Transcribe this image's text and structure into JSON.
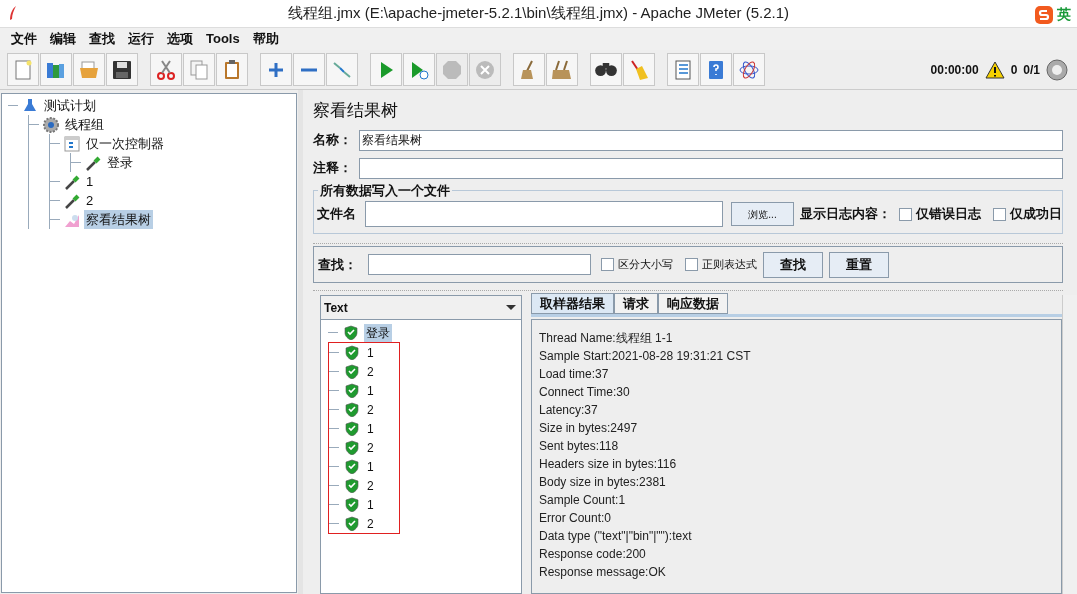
{
  "window": {
    "title": "线程组.jmx (E:\\apache-jmeter-5.2.1\\bin\\线程组.jmx) - Apache JMeter (5.2.1)"
  },
  "ime": {
    "label": "英"
  },
  "menu": [
    "文件",
    "编辑",
    "查找",
    "运行",
    "选项",
    "Tools",
    "帮助"
  ],
  "toolbar": [
    [
      {
        "disabled": false
      },
      {
        "disabled": false
      },
      {
        "disabled": false
      },
      {
        "disabled": false
      }
    ],
    [
      {
        "disabled": false
      },
      {
        "disabled": false
      },
      {
        "disabled": false
      }
    ],
    [
      {
        "disabled": false
      },
      {
        "disabled": false
      },
      {
        "disabled": false
      }
    ],
    [
      {
        "disabled": false
      },
      {
        "disabled": false
      },
      {
        "disabled": true
      },
      {
        "disabled": true
      }
    ],
    [
      {
        "disabled": false
      },
      {
        "disabled": false
      }
    ],
    [
      {
        "disabled": false
      },
      {
        "disabled": false
      }
    ],
    [
      {
        "disabled": false
      },
      {
        "disabled": false
      },
      {
        "disabled": false
      }
    ]
  ],
  "status": {
    "timer": "00:00:00",
    "warnings": "0",
    "threads": "0/1"
  },
  "tree": [
    {
      "label": "测试计划",
      "kind": "plan",
      "selected": false,
      "children": [
        {
          "label": "线程组",
          "kind": "group",
          "selected": false,
          "children": [
            {
              "label": "仅一次控制器",
              "kind": "controller",
              "selected": false,
              "children": [
                {
                  "label": "登录",
                  "kind": "sampler",
                  "selected": false
                }
              ]
            },
            {
              "label": "1",
              "kind": "sampler",
              "selected": false
            },
            {
              "label": "2",
              "kind": "sampler",
              "selected": false
            },
            {
              "label": "察看结果树",
              "kind": "listener",
              "selected": true
            }
          ]
        }
      ]
    }
  ],
  "panel": {
    "title": "察看结果树",
    "name_label": "名称：",
    "name_value": "察看结果树",
    "comment_label": "注释：",
    "file_group": {
      "legend": "所有数据写入一个文件",
      "file_label": "文件名",
      "browse": "浏览...",
      "log_label": "显示日志内容：",
      "checks": [
        {
          "label": "仅错误日志",
          "checked": false
        },
        {
          "label": "仅成功日",
          "checked": false
        }
      ]
    },
    "search": {
      "label": "查找：",
      "checks": [
        {
          "label": "区分大小写",
          "checked": false
        },
        {
          "label": "正则表达式",
          "checked": false
        }
      ],
      "buttons": [
        "查找",
        "重置"
      ]
    },
    "renderer": "Text",
    "results": [
      {
        "label": "登录",
        "selected": true
      }
    ],
    "boxed_results": [
      {
        "label": "1",
        "selected": false
      },
      {
        "label": "2",
        "selected": false
      },
      {
        "label": "1",
        "selected": false
      },
      {
        "label": "2",
        "selected": false
      },
      {
        "label": "1",
        "selected": false
      },
      {
        "label": "2",
        "selected": false
      },
      {
        "label": "1",
        "selected": false
      },
      {
        "label": "2",
        "selected": false
      },
      {
        "label": "1",
        "selected": false
      },
      {
        "label": "2",
        "selected": false
      }
    ],
    "tabs": [
      {
        "label": "取样器结果",
        "selected": true
      },
      {
        "label": "请求",
        "selected": false
      },
      {
        "label": "响应数据",
        "selected": false
      }
    ],
    "sample_lines": [
      "Thread Name:线程组 1-1",
      "Sample Start:2021-08-28 19:31:21 CST",
      "Load time:37",
      "Connect Time:30",
      "Latency:37",
      "Size in bytes:2497",
      "Sent bytes:118",
      "Headers size in bytes:116",
      "Body size in bytes:2381",
      "Sample Count:1",
      "Error Count:0",
      "Data type (\"text\"|\"bin\"|\"\"):text",
      "Response code:200",
      "Response message:OK"
    ]
  }
}
